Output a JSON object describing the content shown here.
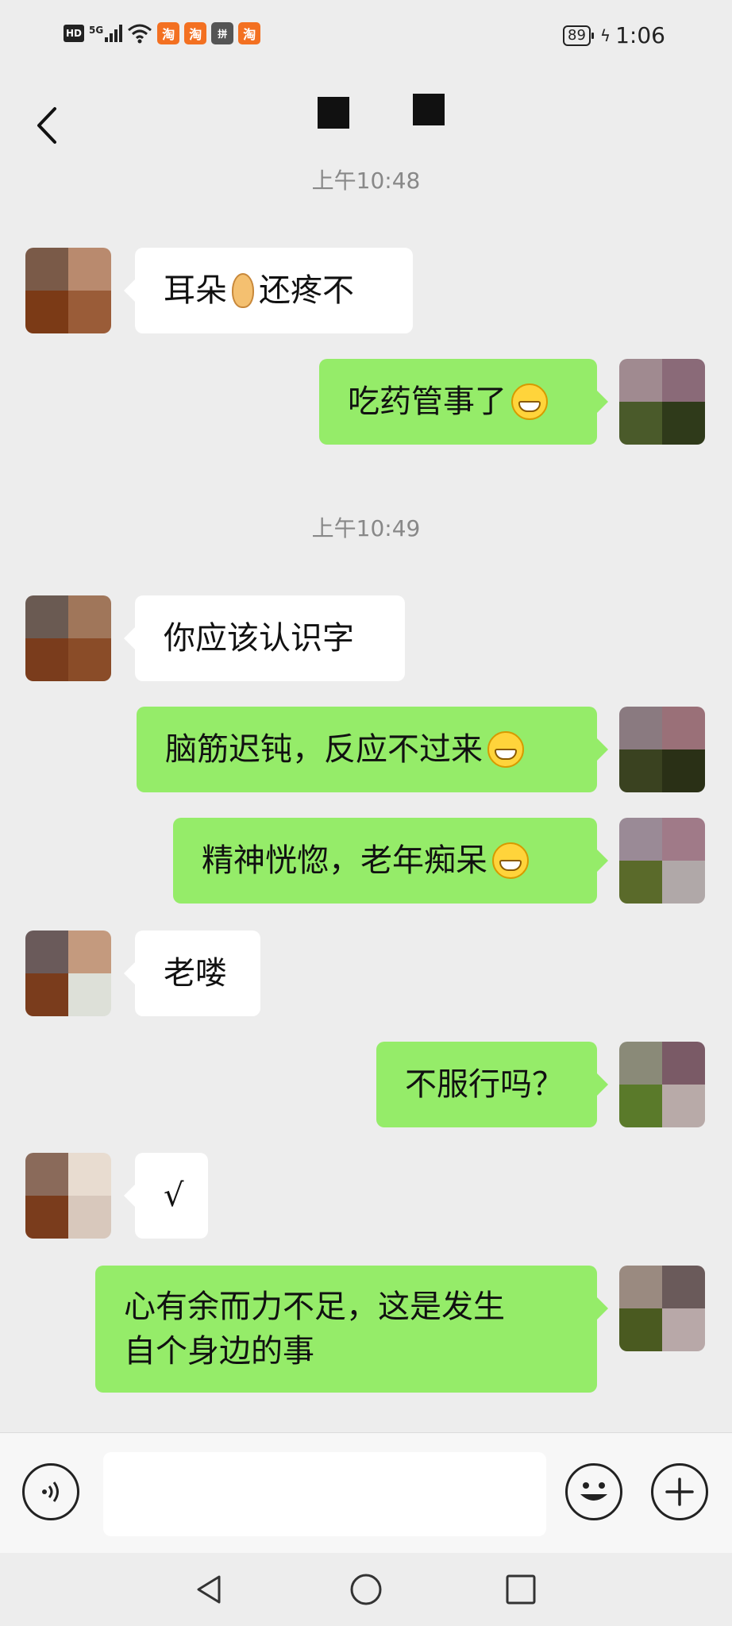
{
  "status_bar": {
    "hd": "HD",
    "network": "5G",
    "apps": [
      "淘",
      "淘",
      "拼",
      "淘"
    ],
    "battery": "89",
    "time": "1:06"
  },
  "header": {
    "title": ""
  },
  "timestamps": {
    "top_partial": "上午10:48",
    "mid": "上午10:49"
  },
  "messages": [
    {
      "side": "in",
      "text_before": "耳朵",
      "emoji": "ear",
      "text_after": "还疼不"
    },
    {
      "side": "out",
      "text": "吃药管事了",
      "emoji": "grin"
    },
    {
      "side": "in",
      "text": "你应该认识字"
    },
    {
      "side": "out",
      "text": "脑筋迟钝，反应不过来",
      "emoji": "grin"
    },
    {
      "side": "out",
      "text": "精神恍惚，老年痴呆",
      "emoji": "grin"
    },
    {
      "side": "in",
      "text": "老喽"
    },
    {
      "side": "out",
      "text": "不服行吗？"
    },
    {
      "side": "in",
      "text": "√"
    },
    {
      "side": "out",
      "text_line1": "心有余而力不足，这是发生",
      "text_line2": "自个身边的事"
    }
  ],
  "colors": {
    "background": "#ededed",
    "bubble_out": "#95ec69",
    "bubble_in": "#ffffff",
    "timestamp": "#888888"
  },
  "icons": {
    "back": "chevron-left-icon",
    "voice": "voice-icon",
    "emoji": "smiley-icon",
    "plus": "plus-icon",
    "nav_back": "triangle-back-icon",
    "nav_home": "circle-home-icon",
    "nav_recent": "square-recent-icon"
  }
}
